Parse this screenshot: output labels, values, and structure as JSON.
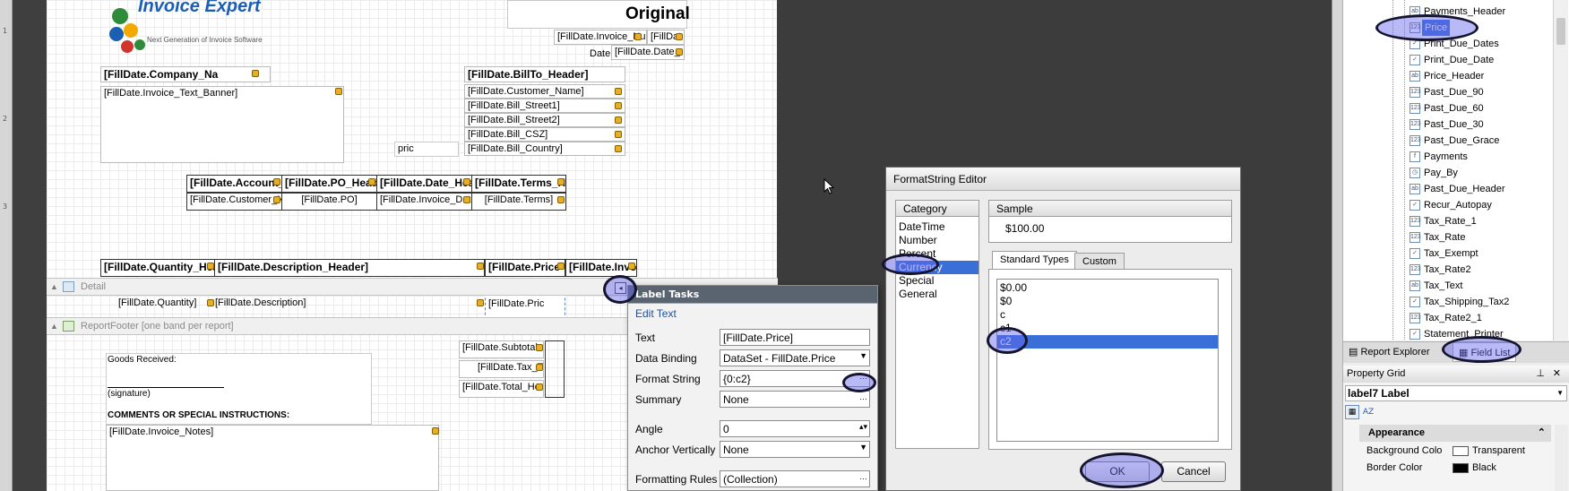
{
  "report": {
    "logo_text": "Invoice Expert",
    "original_label": "Original",
    "date_label": "Date:",
    "pric_label": "pric",
    "fields": {
      "invoice_num": "[FillDate.Invoice_Nu",
      "fill_dat": "[FillDat",
      "date": "[FillDate.Date_",
      "company_name": "[FillDate.Company_Na",
      "invoice_text_banner": "[FillDate.Invoice_Text_Banner]",
      "billto_header": "[FillDate.BillTo_Header]",
      "customer_name": "[FillDate.Customer_Name]",
      "bill_street1": "[FillDate.Bill_Street1]",
      "bill_street2": "[FillDate.Bill_Street2]",
      "bill_csz": "[FillDate.Bill_CSZ]",
      "bill_country": "[FillDate.Bill_Country]",
      "account_h": "[FillDate.Account_",
      "po_head": "[FillDate.PO_Head",
      "date_hea": "[FillDate.Date_Hea",
      "terms_h": "[FillDate.Terms_H",
      "customer_n": "[FillDate.Customer_N",
      "po": "[FillDate.PO]",
      "invoice_dat": "[FillDate.Invoice_Dat",
      "terms": "[FillDate.Terms]",
      "quantity_hea": "[FillDate.Quantity_Hea",
      "description_header": "[FillDate.Description_Header]",
      "price_h": "[FillDate.Price",
      "invo_h": "[FillDate.Invo",
      "quantity": "[FillDate.Quantity]",
      "description": "[FillDate.Description]",
      "price": "[FillDate.Pric",
      "subtotal": "[FillDate.Subtotal",
      "tax_tex": "[FillDate.Tax_Tex",
      "total_he": "[FillDate.Total_He",
      "invoice_notes": "[FillDate.Invoice_Notes]"
    },
    "goods_received": "Goods Received:",
    "signature": "(signature)",
    "comments": "COMMENTS OR SPECIAL INSTRUCTIONS:",
    "band_detail": "Detail",
    "band_footer": "ReportFooter [one band per report]",
    "ruler_marks": [
      "1",
      "2",
      "3"
    ]
  },
  "label_tasks": {
    "title": "Label Tasks",
    "edit_text": "Edit Text",
    "rows": [
      {
        "label": "Text",
        "value": "[FillDate.Price]"
      },
      {
        "label": "Data Binding",
        "value": "DataSet - FillDate.Price"
      },
      {
        "label": "Format String",
        "value": "{0:c2}"
      },
      {
        "label": "Summary",
        "value": "None"
      },
      {
        "label": "Angle",
        "value": "0"
      },
      {
        "label": "Anchor Vertically",
        "value": "None"
      },
      {
        "label": "Formatting Rules",
        "value": "(Collection)"
      }
    ]
  },
  "format_editor": {
    "title": "FormatString Editor",
    "category_header": "Category",
    "categories": [
      "DateTime",
      "Number",
      "Percent",
      "Currency",
      "Special",
      "General"
    ],
    "selected_category": "Currency",
    "sample_header": "Sample",
    "sample_value": "$100.00",
    "tabs": [
      "Standard Types",
      "Custom"
    ],
    "types": [
      "$0.00",
      "$0",
      "c",
      "c1",
      "c2"
    ],
    "selected_type": "c2",
    "ok": "OK",
    "cancel": "Cancel"
  },
  "field_list": {
    "items": [
      {
        "name": "Payments_Header",
        "icon": "ab"
      },
      {
        "name": "Price",
        "icon": "123",
        "selected": true
      },
      {
        "name": "Print_Due_Dates",
        "icon": "check"
      },
      {
        "name": "Print_Due_Date",
        "icon": "check"
      },
      {
        "name": "Price_Header",
        "icon": "ab"
      },
      {
        "name": "Past_Due_90",
        "icon": "123"
      },
      {
        "name": "Past_Due_60",
        "icon": "123"
      },
      {
        "name": "Past_Due_30",
        "icon": "123"
      },
      {
        "name": "Past_Due_Grace",
        "icon": "123"
      },
      {
        "name": "Payments",
        "icon": "f"
      },
      {
        "name": "Pay_By",
        "icon": "clock"
      },
      {
        "name": "Past_Due_Header",
        "icon": "ab"
      },
      {
        "name": "Recur_Autopay",
        "icon": "check"
      },
      {
        "name": "Tax_Rate_1",
        "icon": "123"
      },
      {
        "name": "Tax_Rate",
        "icon": "123"
      },
      {
        "name": "Tax_Exempt",
        "icon": "check"
      },
      {
        "name": "Tax_Rate2",
        "icon": "123"
      },
      {
        "name": "Tax_Text",
        "icon": "ab"
      },
      {
        "name": "Tax_Shipping_Tax2",
        "icon": "check"
      },
      {
        "name": "Tax_Rate2_1",
        "icon": "123"
      },
      {
        "name": "Statement_Printer",
        "icon": "check"
      }
    ],
    "tab_report_explorer": "Report Explorer",
    "tab_field_list": "Field List"
  },
  "property_grid": {
    "title": "Property Grid",
    "object": "label7  Label",
    "section": "Appearance",
    "rows": [
      {
        "key": "Background Colo",
        "value": "Transparent",
        "swatch": "#ffffff"
      },
      {
        "key": "Border Color",
        "value": "Black",
        "swatch": "#000000"
      }
    ]
  }
}
